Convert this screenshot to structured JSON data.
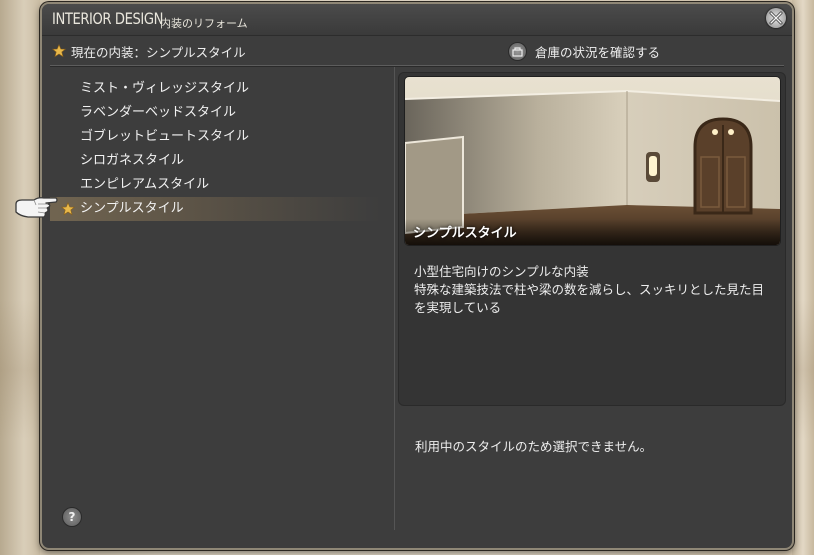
{
  "window": {
    "title": "INTERIOR DESIGN",
    "subtitle": "内装のリフォーム"
  },
  "current": {
    "label": "現在の内装：シンプルスタイル"
  },
  "storage": {
    "label": "倉庫の状況を確認する"
  },
  "styles": [
    {
      "label": "ミスト・ヴィレッジスタイル",
      "selected": false,
      "current": false
    },
    {
      "label": "ラベンダーベッドスタイル",
      "selected": false,
      "current": false
    },
    {
      "label": "ゴブレットビュートスタイル",
      "selected": false,
      "current": false
    },
    {
      "label": "シロガネスタイル",
      "selected": false,
      "current": false
    },
    {
      "label": "エンピレアムスタイル",
      "selected": false,
      "current": false
    },
    {
      "label": "シンプルスタイル",
      "selected": true,
      "current": true
    }
  ],
  "preview": {
    "caption": "シンプルスタイル",
    "description": "小型住宅向けのシンプルな内装\n特殊な建築技法で柱や梁の数を減らし、スッキリとした見た目を実現している"
  },
  "status_message": "利用中のスタイルのため選択できません。",
  "help_label": "?",
  "colors": {
    "star": "#e8b84a",
    "panel_bg": "#3d3d3d",
    "frame": "#8f8776"
  }
}
